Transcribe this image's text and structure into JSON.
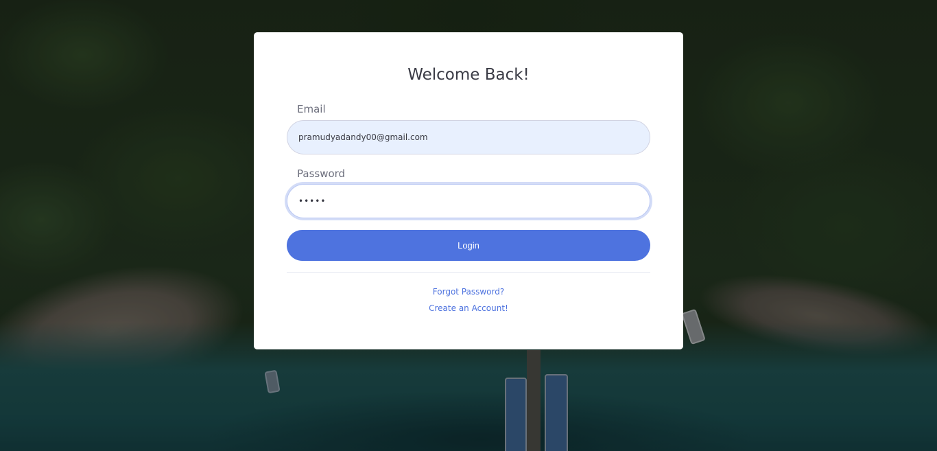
{
  "login": {
    "title": "Welcome Back!",
    "email_label": "Email",
    "email_value": "pramudyadandy00@gmail.com",
    "password_label": "Password",
    "password_value": "•••••",
    "login_button": "Login",
    "forgot_password": "Forgot Password?",
    "create_account": "Create an Account!"
  },
  "colors": {
    "primary": "#4e73df",
    "card": "#ffffff",
    "email_field_bg": "#e8f0fe"
  }
}
